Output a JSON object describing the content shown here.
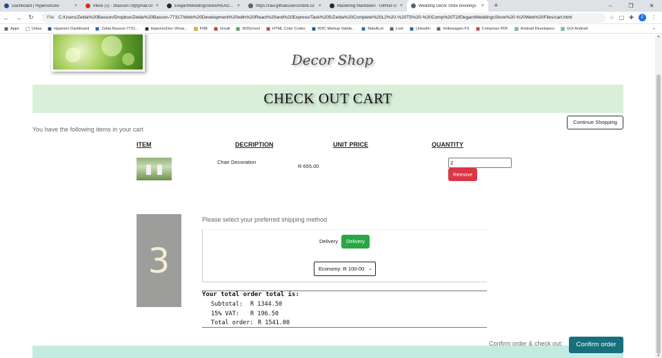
{
  "browser": {
    "tabs": [
      {
        "label": "Dashboard | HyperionDev",
        "favicon_color": "#1f4e8c",
        "active": false
      },
      {
        "label": "Inbox (1) - zbasson73@gmail.co",
        "favicon_color": "#d93025",
        "active": false
      },
      {
        "label": "ElegantWeddingsStore/README",
        "favicon_color": "#24292e",
        "active": false
      },
      {
        "label": "https://raw.githubusercontent.co",
        "favicon_color": "#5f6368",
        "active": false
      },
      {
        "label": "Mastering Markdown · GitHub G",
        "favicon_color": "#24292e",
        "active": false
      },
      {
        "label": "Wedding Decor Store Bookings",
        "favicon_color": "#5f6368",
        "active": true
      }
    ],
    "tab_close_glyph": "×",
    "new_tab_glyph": "+",
    "window_controls": [
      "–",
      "❐",
      "✕"
    ],
    "nav": {
      "back": "←",
      "forward": "→",
      "reload": "↻"
    },
    "address": {
      "info_label": "File",
      "url": "C:/Users/Zelda%20Basson/Dropbox/Zelda%20Basson-77317/Web%20Development%20with%20React%20and%20Express/Task%205/Zelda%20Complete%20L2%20-%20T5%20-%20Comp%20T2/ElegantWeddingsStore%20-%20Web%20Files/cart.html"
    },
    "profile_initial": "Z",
    "bookmarks": [
      {
        "label": "Apps",
        "color": "#5f6368"
      },
      {
        "label": "Unisa",
        "color": "#ffffff"
      },
      {
        "label": "Hyperion Dashboard",
        "color": "#1f4e8c"
      },
      {
        "label": "Zelda Basson-7731...",
        "color": "#0061fe"
      },
      {
        "label": "HyperionDev Virtua...",
        "color": "#1f2a44"
      },
      {
        "label": "FNB",
        "color": "#f7a800"
      },
      {
        "label": "Gmail",
        "color": "#d93025"
      },
      {
        "label": "W3School",
        "color": "#4caf50"
      },
      {
        "label": "HTML Color Codes",
        "color": "#e53935"
      },
      {
        "label": "W3C Markup Valida...",
        "color": "#005a9c"
      },
      {
        "label": "TakeALot",
        "color": "#0b79bf"
      },
      {
        "label": "Loot",
        "color": "#5f6368"
      },
      {
        "label": "LinkedIn",
        "color": "#0a66c2"
      },
      {
        "label": "Volkswagen FS",
        "color": "#5f6368"
      },
      {
        "label": "Compress PDF",
        "color": "#e53935"
      },
      {
        "label": "Android Developers",
        "color": "#3ddc84"
      },
      {
        "label": "GUI Android",
        "color": "#3ddc84"
      }
    ],
    "bookmarks_overflow": "»"
  },
  "header": {
    "shop_title": "Decor Shop"
  },
  "cart": {
    "banner_title": "CHECK OUT CART",
    "continue_label": "Continue Shopping",
    "intro_text": "You have the following items in your cart",
    "columns": {
      "item": "ITEM",
      "description": "DECRIPTION",
      "unit_price": "UNIT PRICE",
      "quantity": "QUANTITY"
    },
    "items": [
      {
        "description": "Chair Decoration",
        "unit_price": "R 655.00",
        "quantity": "2",
        "remove_label": "Remove"
      }
    ]
  },
  "shipping": {
    "step_number": "3",
    "prompt": "Please select your preferred shipping method",
    "delivery_label": "Delivery",
    "delivery_button": "Delivery",
    "selected_option": "Economy: R 100-00"
  },
  "totals": {
    "title": "Your total order total is:",
    "subtotal_label": "Subtotal:",
    "subtotal_value": "R 1344.50",
    "vat_label": "15% VAT:",
    "vat_value": "R 196.50",
    "total_label": "Total order:",
    "total_value": "R 1541.00"
  },
  "confirm": {
    "label": "Confirm order & check out:",
    "button": "Confirm order"
  },
  "colors": {
    "banner_bg": "#d9efda",
    "remove_btn": "#dc3545",
    "delivery_btn": "#28a745",
    "confirm_btn": "#17707c",
    "footer_band": "#c4ebe2",
    "step_box": "#9d9d9b"
  }
}
